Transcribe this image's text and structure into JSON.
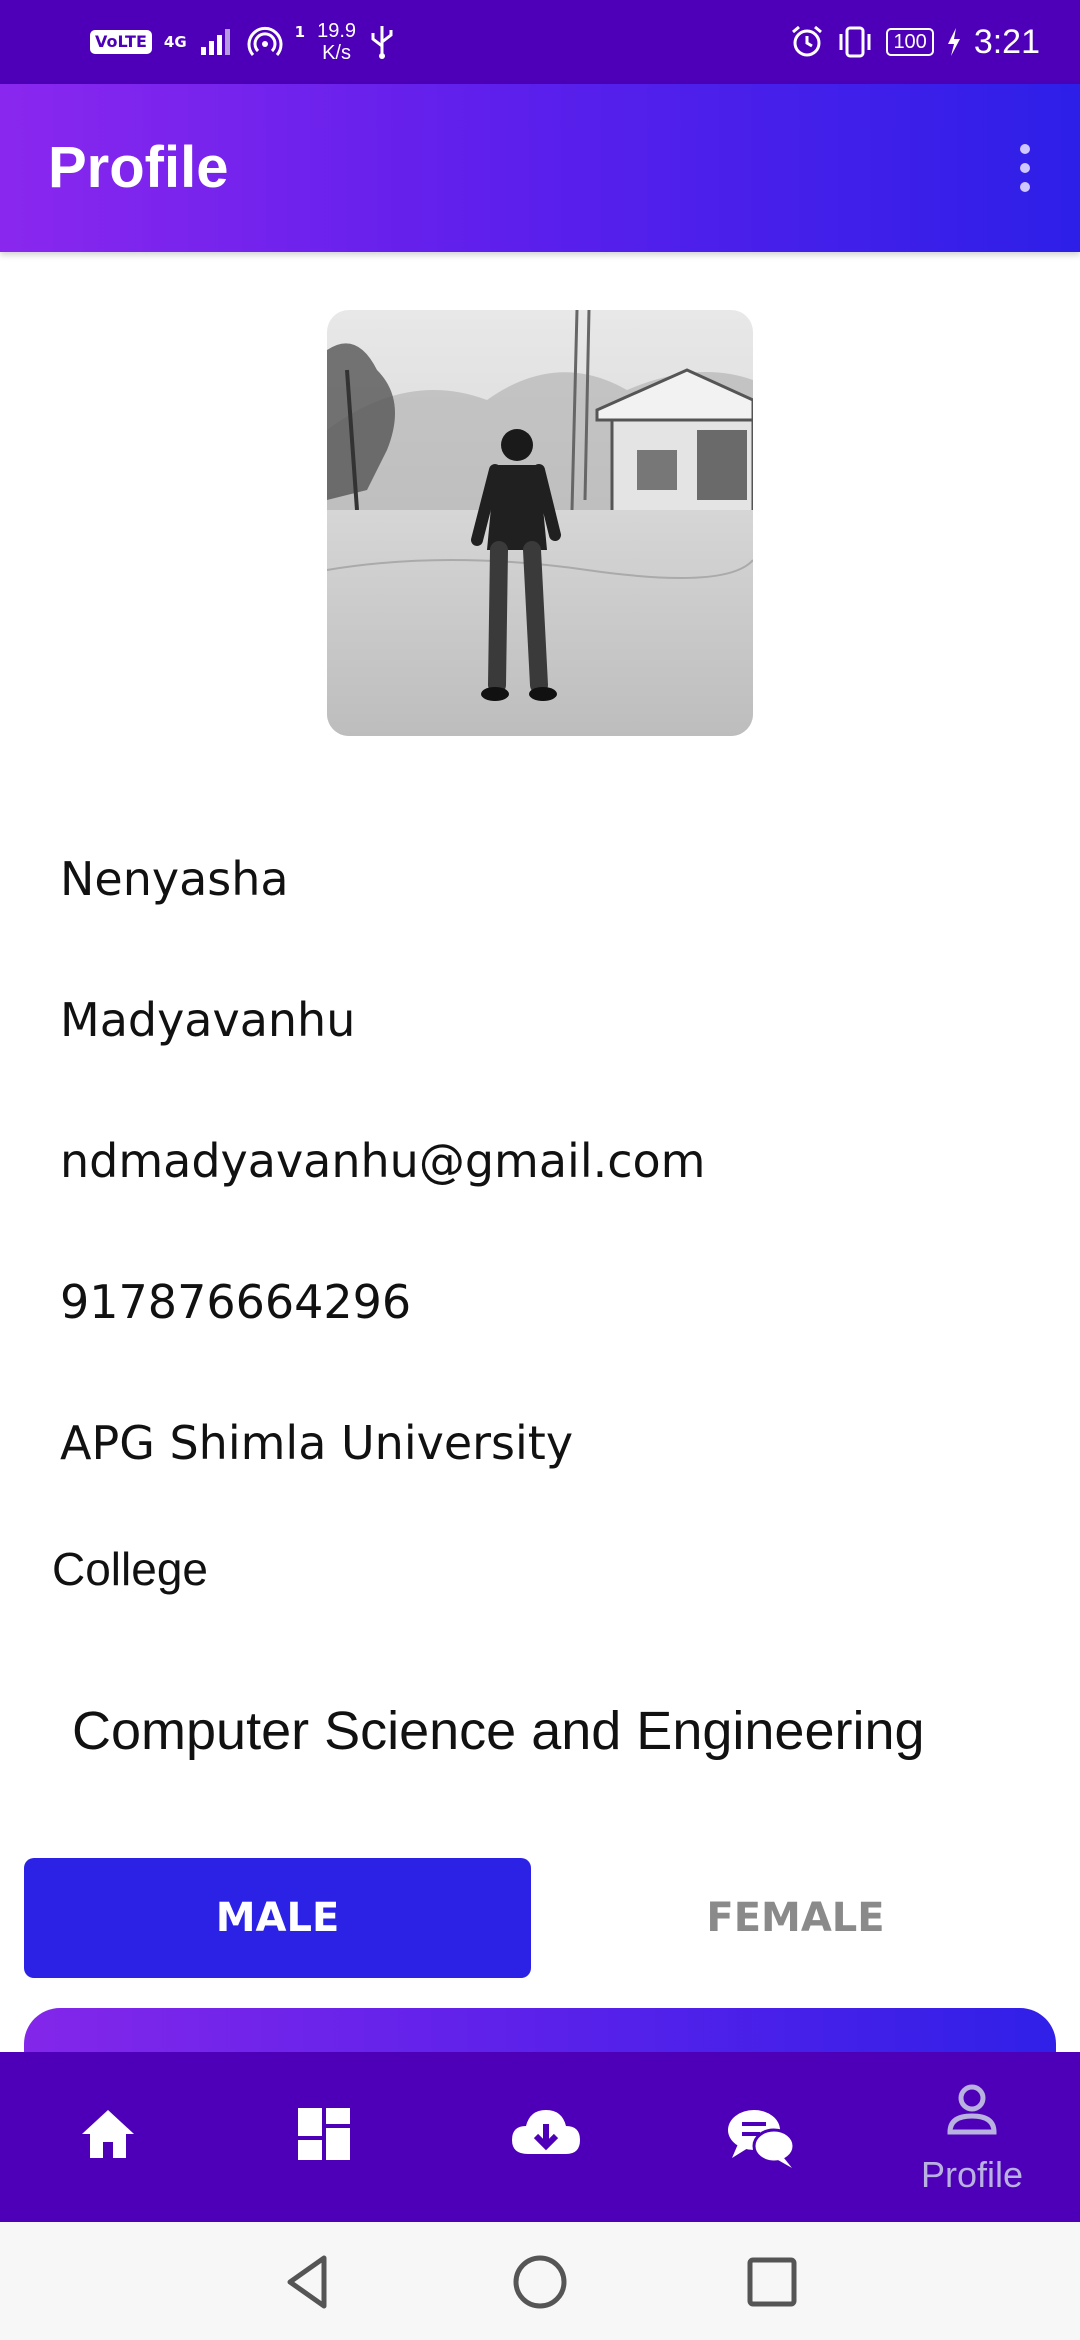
{
  "status_bar": {
    "volte": "VoLTE",
    "network": "4G",
    "data_up": "1",
    "speed_value": "19.9",
    "speed_unit": "K/s",
    "battery": "100",
    "time": "3:21"
  },
  "app_bar": {
    "title": "Profile",
    "menu_icon": "more-vert-icon"
  },
  "profile": {
    "photo_icon": "profile-photo",
    "first_name": "Nenyasha",
    "last_name": "Madyavanhu",
    "email": "ndmadyavanhu@gmail.com",
    "phone": "917876664296",
    "university": "APG Shimla University",
    "college_label": "College",
    "department": "Computer Science and Engineering"
  },
  "gender": {
    "male_label": "MALE",
    "female_label": "FEMALE",
    "selected": "MALE"
  },
  "bottom_nav": {
    "items": [
      {
        "icon": "home-icon"
      },
      {
        "icon": "dashboard-icon"
      },
      {
        "icon": "cloud-download-icon"
      },
      {
        "icon": "chat-icon"
      },
      {
        "icon": "person-icon",
        "label": "Profile"
      }
    ]
  },
  "colors": {
    "status_bar": "#4d00b8",
    "accent": "#2b22e6",
    "gradient_start": "#8a27ee",
    "gradient_end": "#2d1fe8"
  }
}
